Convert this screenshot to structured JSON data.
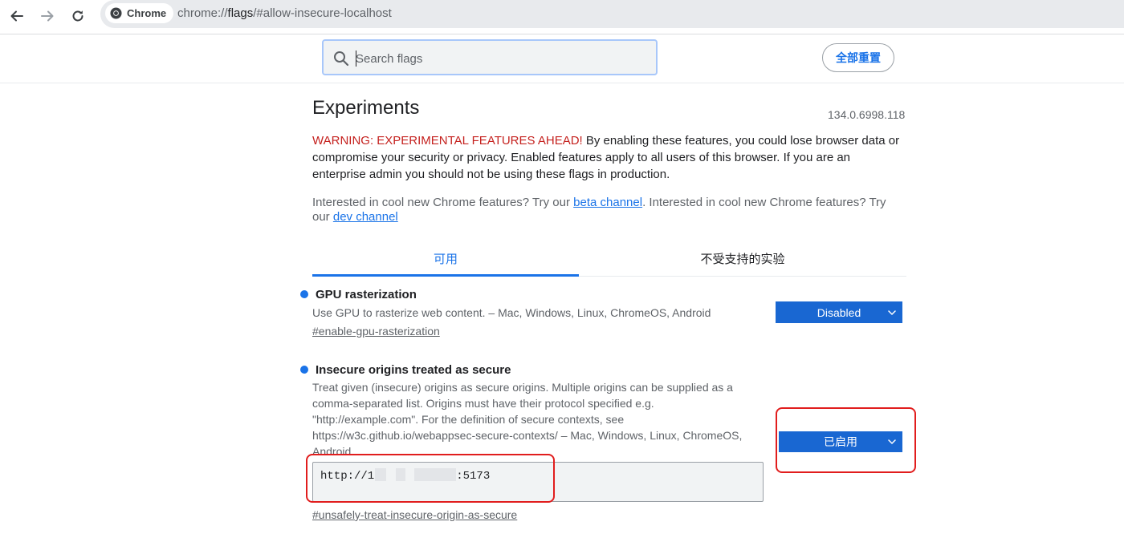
{
  "browser": {
    "chip_label": "Chrome",
    "url_prefix": "chrome://",
    "url_host": "flags",
    "url_suffix": "/#allow-insecure-localhost"
  },
  "search": {
    "placeholder": "Search flags",
    "reset_label": "全部重置"
  },
  "header": {
    "title": "Experiments",
    "version": "134.0.6998.118"
  },
  "warning": {
    "prefix": "WARNING: EXPERIMENTAL FEATURES AHEAD!",
    "body": " By enabling these features, you could lose browser data or compromise your security or privacy. Enabled features apply to all users of this browser. If you are an enterprise admin you should not be using these flags in production."
  },
  "channels": {
    "text1": "Interested in cool new Chrome features? Try our ",
    "beta_link": "beta channel",
    "text2": ". Interested in cool new Chrome features? Try our ",
    "dev_link": "dev channel"
  },
  "tabs": {
    "available": "可用",
    "unsupported": "不受支持的实验"
  },
  "flags": [
    {
      "name": "GPU rasterization",
      "description": "Use GPU to rasterize web content. – Mac, Windows, Linux, ChromeOS, Android",
      "link": "#enable-gpu-rasterization",
      "state": "Disabled"
    },
    {
      "name": "Insecure origins treated as secure",
      "description_lines": [
        "Treat given (insecure) origins as secure origins. Multiple origins can be supplied as a",
        "comma-separated list. Origins must have their protocol specified e.g.",
        "\"http://example.com\". For the definition of secure contexts, see",
        "https://w3c.github.io/webappsec-secure-contexts/ – Mac, Windows, Linux, ChromeOS,",
        "Android"
      ],
      "value_prefix": "http://1",
      "value_suffix": ":5173",
      "link": "#unsafely-treat-insecure-origin-as-secure",
      "state": "已启用"
    }
  ],
  "colors": {
    "accent": "#1a73e8",
    "select_bg": "#1967d2",
    "warning_red": "#c5221f",
    "highlight_red": "#e11d1d"
  }
}
